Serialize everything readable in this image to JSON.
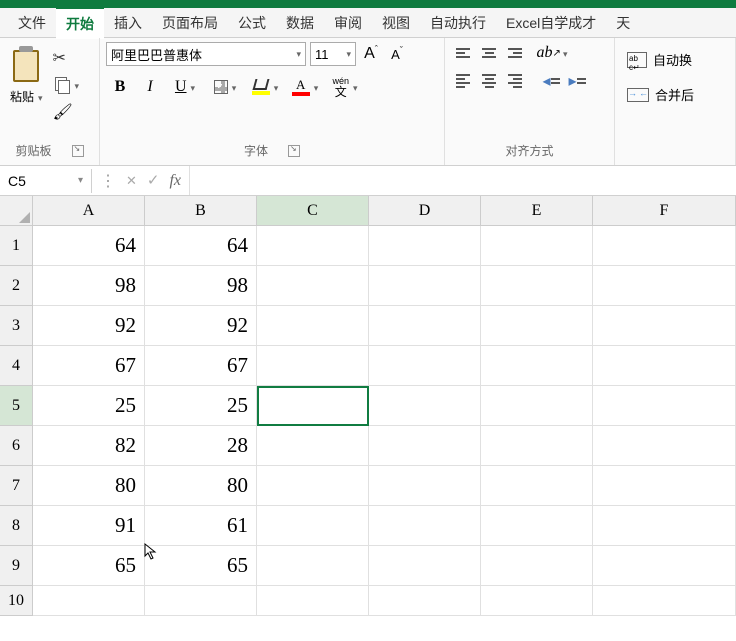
{
  "menubar": {
    "tabs": [
      "文件",
      "开始",
      "插入",
      "页面布局",
      "公式",
      "数据",
      "审阅",
      "视图",
      "自动执行",
      "Excel自学成才",
      "天"
    ],
    "active_index": 1
  },
  "ribbon": {
    "clipboard": {
      "paste": "粘贴",
      "group_label": "剪贴板"
    },
    "font": {
      "name": "阿里巴巴普惠体",
      "size": "11",
      "increase": "A",
      "decrease": "A",
      "bold": "B",
      "italic": "I",
      "underline": "U",
      "wen_top": "wén",
      "wen_bottom": "文",
      "group_label": "字体"
    },
    "align": {
      "group_label": "对齐方式",
      "wrap_label": "自动换",
      "merge_label": "合并后"
    }
  },
  "namebox": "C5",
  "fx": "fx",
  "columns": [
    "A",
    "B",
    "C",
    "D",
    "E",
    "F"
  ],
  "rows": [
    "1",
    "2",
    "3",
    "4",
    "5",
    "6",
    "7",
    "8",
    "9",
    "10"
  ],
  "cells": {
    "A": [
      64,
      98,
      92,
      67,
      25,
      82,
      80,
      91,
      65
    ],
    "B": [
      64,
      98,
      92,
      67,
      25,
      28,
      80,
      61,
      65
    ]
  },
  "active": {
    "col": "C",
    "row": 5
  }
}
